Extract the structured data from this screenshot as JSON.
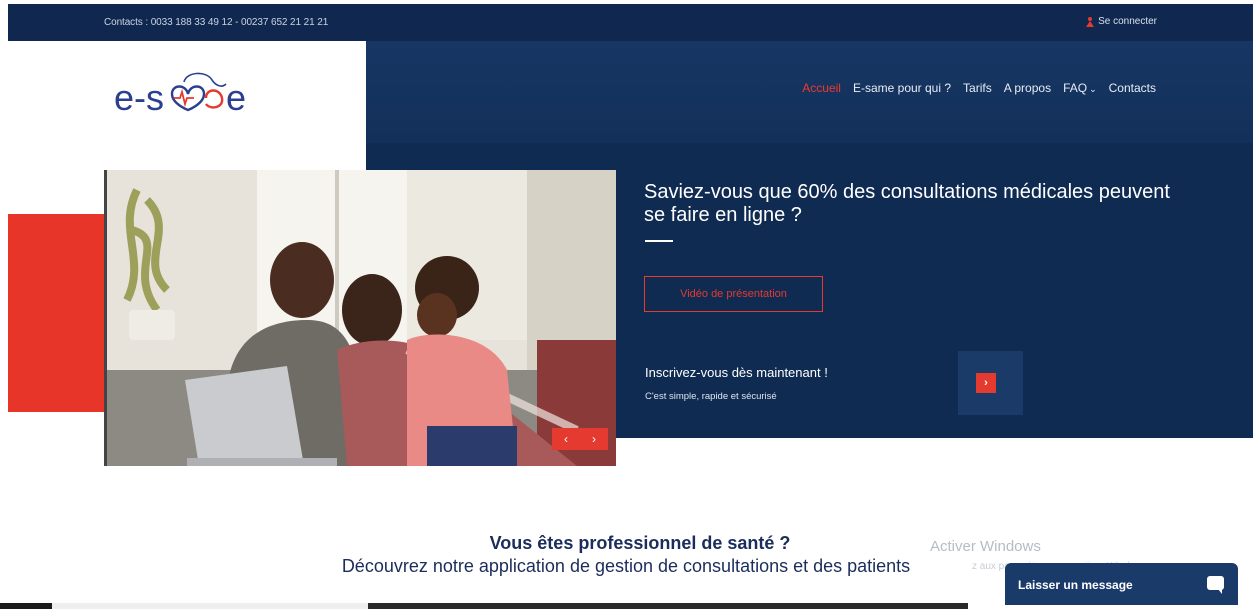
{
  "topbar": {
    "contacts": "Contacts : 0033 188 33 49 12 - 00237 652 21 21 21",
    "login": "Se connecter"
  },
  "logo": {
    "text": "e-same"
  },
  "nav": {
    "items": [
      {
        "label": "Accueil",
        "active": true
      },
      {
        "label": "E-same pour qui ?"
      },
      {
        "label": "Tarifs"
      },
      {
        "label": "A propos"
      },
      {
        "label": "FAQ"
      },
      {
        "label": "Contacts"
      }
    ],
    "faq_chevron": "⌄"
  },
  "hero": {
    "title": "Saviez-vous que 60% des consultations médicales peuvent se faire en ligne ?",
    "video_button": "Vidéo de présentation",
    "signup_title": "Inscrivez-vous dès maintenant !",
    "signup_sub": "C'est simple, rapide et sécurisé",
    "arrow_icon": "chevron-right-icon",
    "slider_prev": "‹",
    "slider_next": "›"
  },
  "section": {
    "title": "Vous êtes professionnel de santé ?",
    "subtitle": "Découvrez notre application de gestion de consultations et des patients"
  },
  "windows": {
    "watermark": "Activer Windows",
    "sub": "z aux paramètres pour activer Windows."
  },
  "chat": {
    "label": "Laisser un message"
  },
  "colors": {
    "navy": "#10284f",
    "hero_navy": "#0f2b52",
    "accent_red": "#e53a2f",
    "logo_blue": "#2c3f8f"
  }
}
